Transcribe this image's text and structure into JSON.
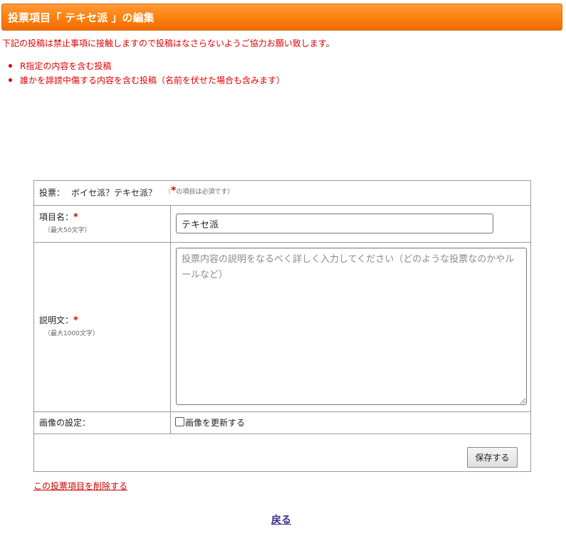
{
  "header": {
    "title": "投票項目「 テキセ派 」の編集"
  },
  "notice": {
    "text": "下記の投稿は禁止事項に接触しますので投稿はなさらないようご協力お願い致します。",
    "rules": [
      "R指定の内容を含む投稿",
      "誰かを誹謗中傷する内容を含む投稿（名前を伏せた場合も含みます）"
    ]
  },
  "form": {
    "vote_label": "投票：",
    "vote_name": "ボイセ派？テキセ派？",
    "required_note_open": "（",
    "required_star": "*",
    "required_note_text": "の項目は必須です）",
    "item_name": {
      "label": "項目名：",
      "required": "*",
      "limit": "（最大50文字）",
      "value": "テキセ派"
    },
    "description": {
      "label": "説明文：",
      "required": "*",
      "limit": "（最大1000文字）",
      "placeholder": "投票内容の説明をなるべく詳しく入力してください（どのような投票なのかやルールなど）",
      "value": ""
    },
    "image": {
      "label": "画像の設定：",
      "checkbox_label": "画像を更新する",
      "checked": false
    },
    "save_label": "保存する"
  },
  "delete_link": "この投票項目を削除する",
  "back_link": "戻る",
  "colors": {
    "header_orange": "#ff8512",
    "warning_red": "#e00000",
    "back_link_purple": "#3b2a8c"
  },
  "icons": [
    "checkbox-icon",
    "resize-grip-icon",
    "bullet-icon"
  ]
}
